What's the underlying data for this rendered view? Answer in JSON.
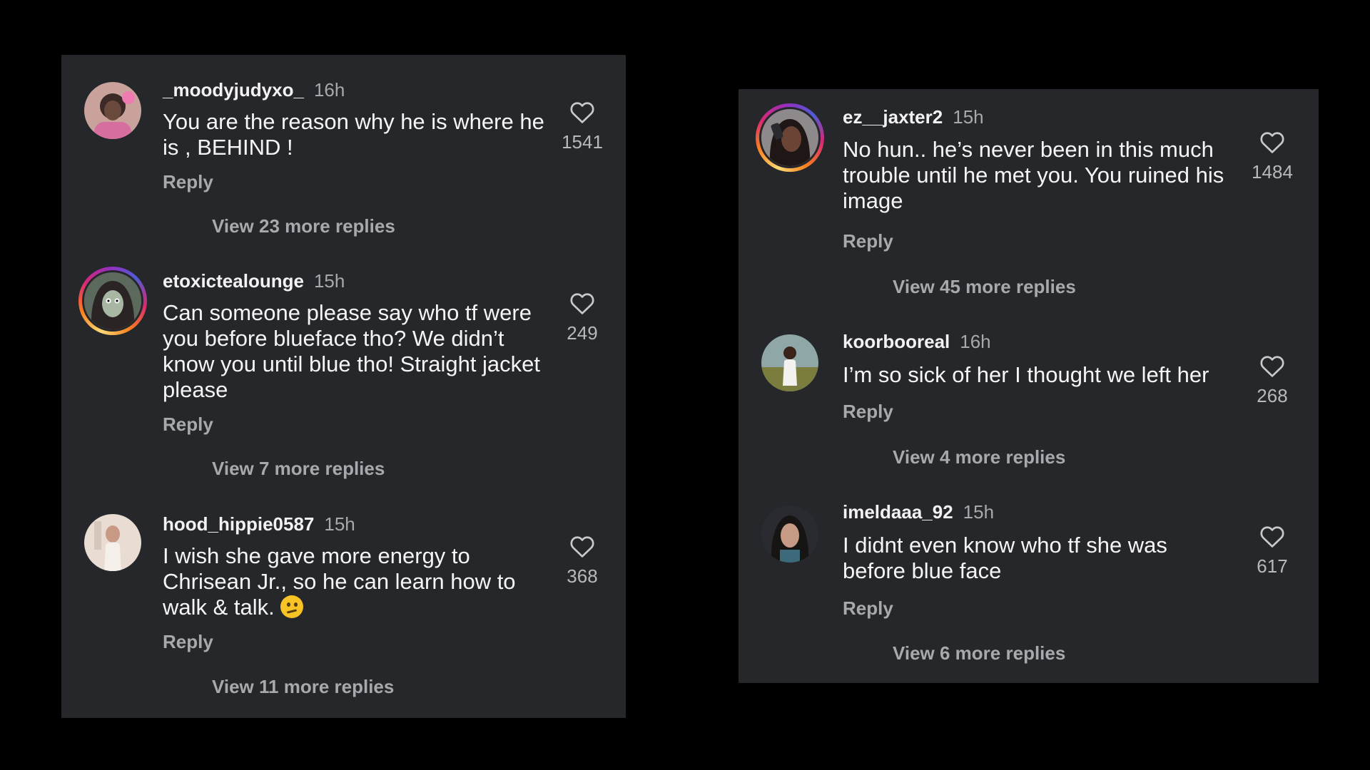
{
  "left_panel": {
    "comments": [
      {
        "username": "_moodyjudyxo_",
        "time": "16h",
        "text": "You are the reason why he is where he is , BEHIND !",
        "likes": "1541",
        "reply_label": "Reply",
        "more_replies": "View 23 more replies",
        "avatar_ring": false
      },
      {
        "username": "etoxictealounge",
        "time": "15h",
        "text": "Can someone please say who tf were you before blueface tho? We didn’t know you until blue tho! Straight jacket please",
        "likes": "249",
        "reply_label": "Reply",
        "more_replies": "View 7 more replies",
        "avatar_ring": true
      },
      {
        "username": "hood_hippie0587",
        "time": "15h",
        "text": "I wish she gave more energy to Chrisean Jr., so he can learn how to walk & talk.",
        "likes": "368",
        "reply_label": "Reply",
        "more_replies": "View 11 more replies",
        "avatar_ring": false,
        "emoji": "confused-face-emoji"
      }
    ]
  },
  "right_panel": {
    "comments": [
      {
        "username": "ez__jaxter2",
        "time": "15h",
        "text": "No hun.. he’s never been in this much trouble until he met you. You ruined his image",
        "likes": "1484",
        "reply_label": "Reply",
        "more_replies": "View 45 more replies",
        "avatar_ring": true
      },
      {
        "username": "koorbooreal",
        "time": "16h",
        "text": "I’m so sick of her I thought we left her",
        "likes": "268",
        "reply_label": "Reply",
        "more_replies": "View 4 more replies",
        "avatar_ring": false
      },
      {
        "username": "imeldaaa_92",
        "time": "15h",
        "text": "I didnt even know who tf she was before blue face",
        "likes": "617",
        "reply_label": "Reply",
        "more_replies": "View 6 more replies",
        "avatar_ring": false
      }
    ]
  },
  "colors": {
    "background": "#000000",
    "panel": "#25272b",
    "primary_text": "#f5f5f5",
    "secondary_text": "#a8a9ad"
  }
}
